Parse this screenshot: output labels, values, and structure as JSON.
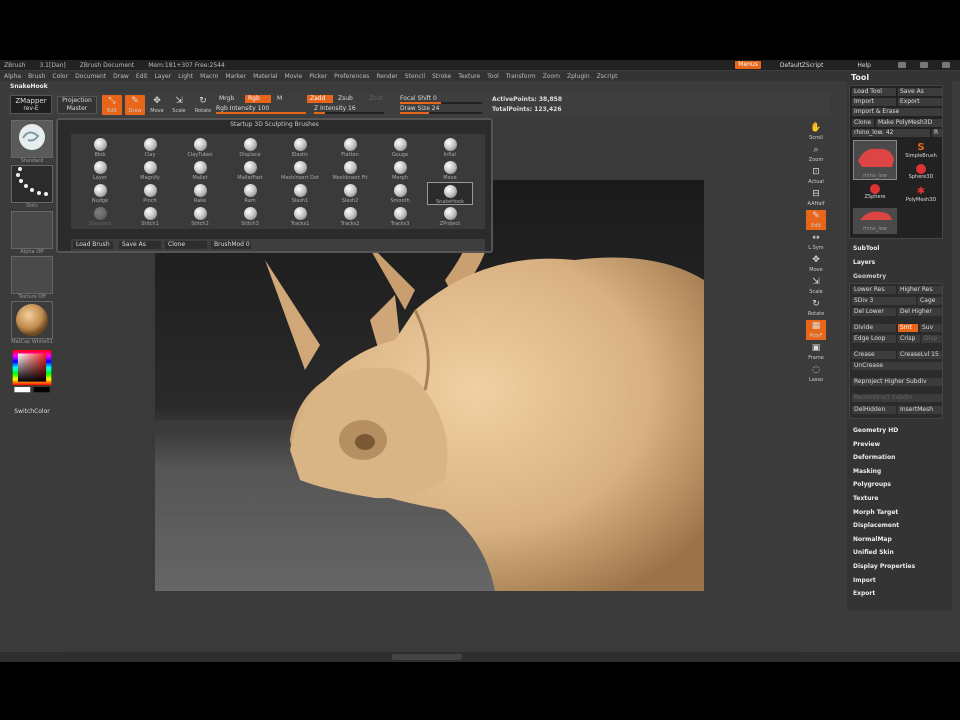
{
  "titlebar": {
    "app_name": "ZBrush",
    "version": "3.1[Dan]",
    "document": "ZBrush Document",
    "mem": "Mem:181+307 Free:2544",
    "menus_btn": "Menus",
    "script": "DefaultZScript",
    "help": "Help"
  },
  "menubar": [
    "Alpha",
    "Brush",
    "Color",
    "Document",
    "Draw",
    "Edit",
    "Layer",
    "Light",
    "Macro",
    "Marker",
    "Material",
    "Movie",
    "Picker",
    "Preferences",
    "Render",
    "Stencil",
    "Stroke",
    "Texture",
    "Tool",
    "Transform",
    "Zoom",
    "Zplugin",
    "Zscript"
  ],
  "brush_name": "SnakeHook",
  "shelf": {
    "zmapper": "ZMapper",
    "zmapper_sub": "rev-E",
    "projection_master": "Projection",
    "projection_master2": "Master",
    "edit_label": "Edit",
    "draw_label": "Draw",
    "move_label": "Move",
    "scale_label": "Scale",
    "rotate_label": "Rotate",
    "mrgb": "Mrgb",
    "rgb": "Rgb",
    "m": "M",
    "rgb_intensity": "Rgb Intensity 100",
    "zadd": "Zadd",
    "zsub": "Zsub",
    "zcut": "Zcut",
    "z_intensity": "Z Intensity 16",
    "focal_shift": "Focal Shift 0",
    "draw_size": "Draw Size 24",
    "active_points": "ActivePoints: 38,858",
    "total_points": "TotalPoints: 123,426",
    "z_intensity_level": 0.16,
    "draw_size_level": 0.35,
    "rgb_intensity_level": 1.0
  },
  "leftshelf": {
    "standard": "Standard",
    "dots": "Dots",
    "alpha_off": "Alpha Off",
    "texture_off": "Texture Off",
    "matcap": "MatCap White01",
    "switch_color": "SwitchColor"
  },
  "rightshelf": [
    "Scroll",
    "Zoom",
    "Actual",
    "AAHalf",
    "Edit",
    "L.Sym",
    "Move",
    "Scale",
    "Rotate",
    "PolyF",
    "Frame",
    "Lasso"
  ],
  "popup": {
    "title": "Startup 3D Sculpting Brushes",
    "brushes": [
      "Blob",
      "Clay",
      "ClayTubes",
      "Displace",
      "Elastic",
      "Flatten",
      "Gouge",
      "Inflat",
      "Layer",
      "Magnify",
      "Mallet",
      "MalletFast",
      "MeshInsert Dot",
      "MeshInsert Fit",
      "Morph",
      "Move",
      "Nudge",
      "Pinch",
      "Rake",
      "Ram",
      "Slash1",
      "Slash2",
      "Smooth",
      "SnakeHook",
      "Standard",
      "Stitch1",
      "Stitch2",
      "Stitch3",
      "Tracks1",
      "Tracks2",
      "Tracks3",
      "ZProject"
    ],
    "load_brush": "Load Brush",
    "save_as": "Save As",
    "clone": "Clone",
    "brushmod": "BrushMod 0"
  },
  "tray": {
    "title": "Tool",
    "load_tool": "Load Tool",
    "save_as": "Save As",
    "import": "Import",
    "export": "Export",
    "import_erase": "Import & Erase",
    "clone": "Clone",
    "make_polymesh": "Make PolyMesh3D",
    "current_tool": "rhino_low. 42",
    "r": "R",
    "thumbs": [
      "rhino_low",
      "SimpleBrush",
      "ZSphere",
      "Sphere3D",
      "PolyMesh3D",
      "rhino_low"
    ],
    "subtool": "SubTool",
    "layers": "Layers",
    "geometry": "Geometry",
    "lower_res": "Lower Res",
    "higher_res": "Higher Res",
    "sdiv": "SDiv 3",
    "cage": "Cage",
    "del_lower": "Del Lower",
    "del_higher": "Del Higher",
    "divide": "Divide",
    "smt": "Smt",
    "suv": "Suv",
    "edge_loop": "Edge Loop",
    "crisp": "Crisp",
    "disp": "Disp",
    "crease": "Crease",
    "crease_lvl": "CreaseLvl 15",
    "uncrease": "UnCrease",
    "reproject": "Reproject Higher Subdiv",
    "reconstruct": "Reconstruct Subdiv",
    "delhidden": "DelHidden",
    "insertmesh": "InsertMesh",
    "sections": [
      "Geometry HD",
      "Preview",
      "Deformation",
      "Masking",
      "Polygroups",
      "Texture",
      "Morph Target",
      "Displacement",
      "NormalMap",
      "Unified Skin",
      "Display Properties",
      "Import",
      "Export"
    ]
  },
  "colors": {
    "accent": "#e8661a",
    "panel": "#3b3b3b",
    "clay": "#d8b182"
  }
}
